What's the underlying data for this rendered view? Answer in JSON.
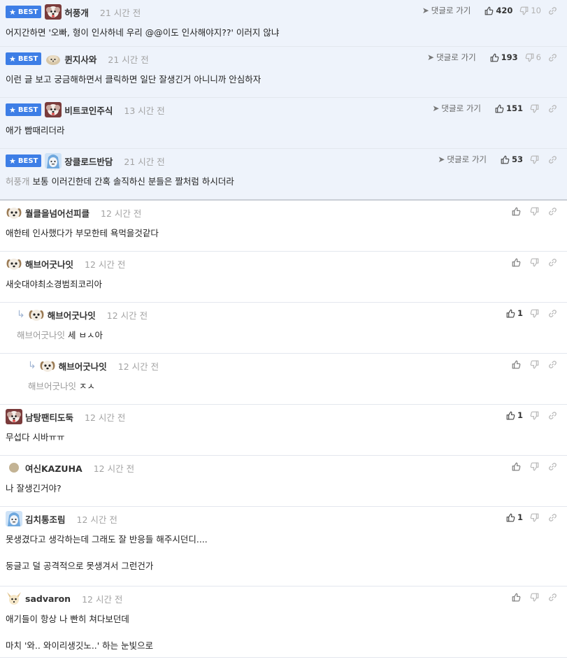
{
  "comments": [
    {
      "best": true,
      "badge": "BEST",
      "avatar": "fluffy-dog-avatar",
      "name": "허풍개",
      "time": "21 시간 전",
      "reply_label": "댓글로 가기",
      "likes": "420",
      "dislikes": "10",
      "mention": "",
      "lines": [
        "어지간하면 '오빠, 형이 인사하네 우리 @@이도 인사해야지??' 이러지 않냐"
      ]
    },
    {
      "best": true,
      "badge": "BEST",
      "avatar": "small-dog-avatar",
      "name": "퀸지사와",
      "time": "21 시간 전",
      "reply_label": "댓글로 가기",
      "likes": "193",
      "dislikes": "6",
      "mention": "",
      "lines": [
        "이런 글 보고 궁금해하면서 클릭하면 일단 잘생긴거 아니니까 안심하자"
      ]
    },
    {
      "best": true,
      "badge": "BEST",
      "avatar": "fluffy-dog-avatar",
      "name": "비트코인주식",
      "time": "13 시간 전",
      "reply_label": "댓글로 가기",
      "likes": "151",
      "dislikes": "",
      "mention": "",
      "lines": [
        "애가 빰때리더라"
      ]
    },
    {
      "best": true,
      "badge": "BEST",
      "avatar": "blue-character-avatar",
      "name": "장클로드반담",
      "time": "21 시간 전",
      "reply_label": "댓글로 가기",
      "likes": "53",
      "dislikes": "",
      "mention": "허풍개",
      "lines": [
        "보통 이러긴한데 간혹 솔직하신 분들은 짤처럼 하시더라"
      ]
    },
    {
      "best": false,
      "avatar": "puppy-avatar",
      "name": "월클을넘어선피클",
      "time": "12 시간 전",
      "likes": "",
      "dislikes": "",
      "mention": "",
      "lines": [
        "애한테 인사했다가 부모한테 욕먹을것같다"
      ]
    },
    {
      "best": false,
      "avatar": "puppy-avatar",
      "name": "해브어굿나잇",
      "time": "12 시간 전",
      "likes": "",
      "dislikes": "",
      "mention": "",
      "lines": [
        "새숫대야최소경범죄코리아"
      ]
    },
    {
      "best": false,
      "reply": true,
      "avatar": "puppy-avatar",
      "name": "해브어굿나잇",
      "time": "12 시간 전",
      "likes": "1",
      "dislikes": "",
      "mention": "해브어굿나잇",
      "lines": [
        "세 ㅂㅅ아"
      ]
    },
    {
      "best": false,
      "reply": true,
      "avatar": "puppy-avatar",
      "name": "해브어굿나잇",
      "time": "12 시간 전",
      "likes": "",
      "dislikes": "",
      "mention": "해브어굿나잇",
      "lines": [
        "ㅈㅅ"
      ]
    },
    {
      "best": false,
      "avatar": "fluffy-dog-avatar",
      "name": "남탕팬티도둑",
      "time": "12 시간 전",
      "likes": "1",
      "dislikes": "",
      "mention": "",
      "lines": [
        "무섭다 시바ㅠㅠ"
      ]
    },
    {
      "best": false,
      "avatar": "level-dot-avatar",
      "name": "여신KAZUHA",
      "time": "12 시간 전",
      "likes": "",
      "dislikes": "",
      "mention": "",
      "lines": [
        "나 잘생긴거야?"
      ]
    },
    {
      "best": false,
      "avatar": "blue-character-avatar",
      "name": "김치통조림",
      "time": "12 시간 전",
      "likes": "1",
      "dislikes": "",
      "mention": "",
      "lines": [
        "못생겼다고 생각하는데 그래도 잘 반응들 해주시던디....",
        "",
        "둥글고 덜 공격적으로 못생겨서 그런건가"
      ]
    },
    {
      "best": false,
      "avatar": "fennec-avatar",
      "name": "sadvaron",
      "time": "12 시간 전",
      "likes": "",
      "dislikes": "",
      "mention": "",
      "lines": [
        "애기들이 항상 나 빤히 쳐다보던데",
        "",
        "마치 '와.. 와이리생깃노..' 하는 눈빛으로"
      ]
    }
  ],
  "colors": {
    "best_bg": "#eef3fb",
    "badge": "#3d7ee6",
    "reply_arrow": "#9fb4d3"
  }
}
